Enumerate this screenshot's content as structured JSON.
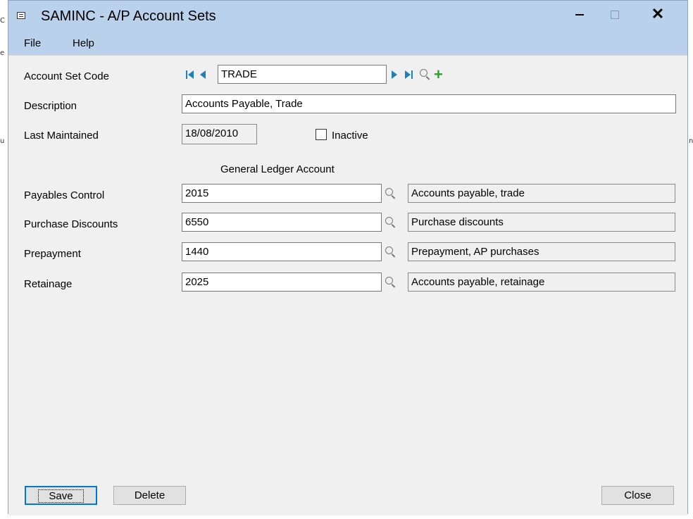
{
  "window": {
    "title": "SAMINC - A/P Account Sets"
  },
  "menu": {
    "file": "File",
    "help": "Help"
  },
  "form": {
    "account_set_code_label": "Account Set Code",
    "account_set_code": "TRADE",
    "description_label": "Description",
    "description": "Accounts Payable, Trade",
    "last_maintained_label": "Last Maintained",
    "last_maintained": "18/08/2010",
    "inactive_label": "Inactive",
    "inactive_checked": false,
    "gl_header": "General Ledger Account"
  },
  "accounts": [
    {
      "label": "Payables Control",
      "code": "2015",
      "description": "Accounts payable, trade"
    },
    {
      "label": "Purchase Discounts",
      "code": "6550",
      "description": "Purchase discounts"
    },
    {
      "label": "Prepayment",
      "code": "1440",
      "description": "Prepayment, AP purchases"
    },
    {
      "label": "Retainage",
      "code": "2025",
      "description": "Accounts payable, retainage"
    }
  ],
  "buttons": {
    "save": "Save",
    "delete": "Delete",
    "close": "Close"
  },
  "icons": {
    "nav_color": "#1f7fb6",
    "add_color": "#2ca02c"
  }
}
